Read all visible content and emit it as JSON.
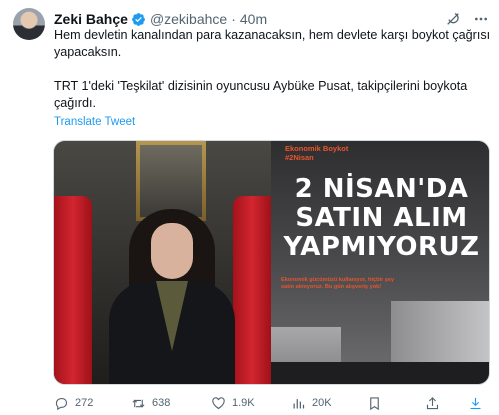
{
  "tweet": {
    "author_name": "Zeki Bahçe",
    "handle": "@zekibahce",
    "separator": "·",
    "time": "40m",
    "paragraph_1": "Hem devletin kanalından para kazanacaksın, hem devlete karşı boykot çağrısı yapacaksın.",
    "paragraph_2": "TRT 1'deki 'Teşkilat' dizisinin oyuncusu Aybüke Pusat, takipçilerini boykota çağırdı.",
    "translate_label": "Translate Tweet"
  },
  "media": {
    "poster": {
      "top_line_1": "Ekonomik Boykot",
      "top_line_2": "#2Nisan",
      "headline_1": "2 NİSAN'DA",
      "headline_2": "SATIN ALIM",
      "headline_3": "YAPMIYORUZ",
      "subtext": "Ekonomik gücümüzü kullanıyor, hiçbir şey satın almıyoruz. Bu gün alışveriş yok!"
    }
  },
  "actions": {
    "replies": "272",
    "retweets": "638",
    "likes": "1.9K",
    "views": "20K"
  },
  "colors": {
    "link": "#1d9bf0",
    "verified": "#1d9bf0",
    "muted": "#536471",
    "poster_accent": "#e8542c"
  },
  "icons": [
    "verified-badge-icon",
    "grok-icon",
    "more-icon",
    "reply-icon",
    "retweet-icon",
    "like-icon",
    "views-icon",
    "bookmark-icon",
    "share-icon"
  ]
}
